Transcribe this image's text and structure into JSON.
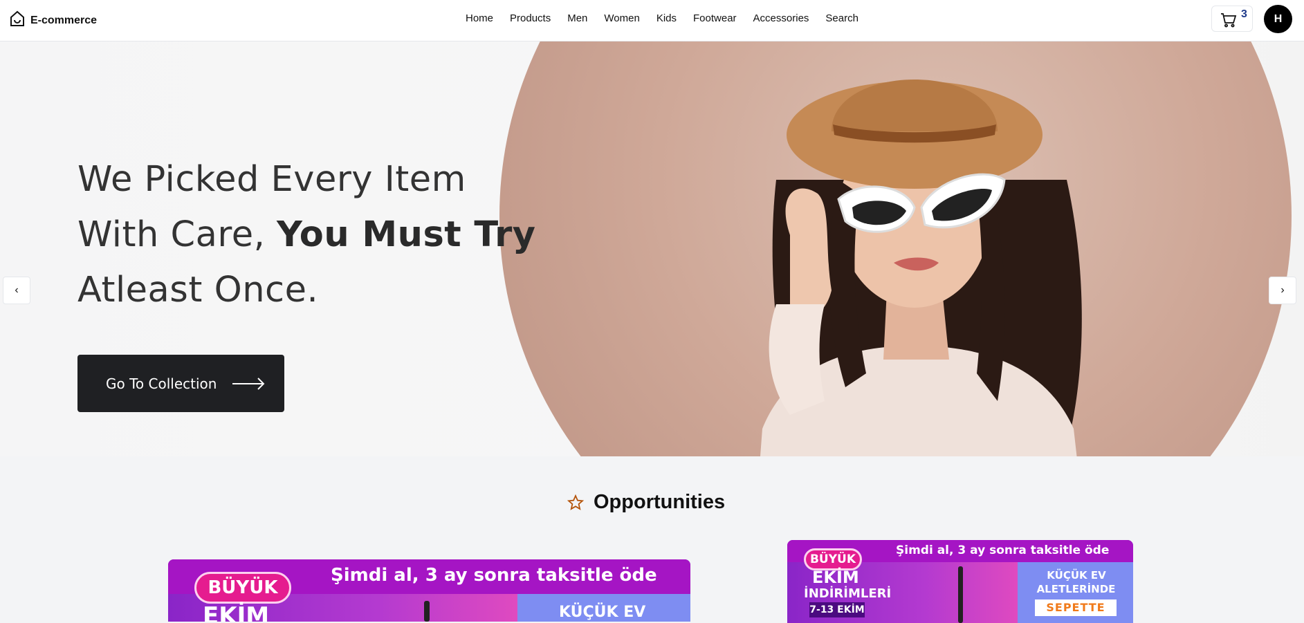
{
  "app": {
    "name": "E-commerce"
  },
  "nav": {
    "links": [
      "Home",
      "Products",
      "Men",
      "Women",
      "Kids",
      "Footwear",
      "Accessories",
      "Search"
    ]
  },
  "cart": {
    "count": "3"
  },
  "user": {
    "initial": "H"
  },
  "hero": {
    "line1": "We Picked Every Item",
    "line2_regular": "With Care, ",
    "line2_bold": "You Must Try",
    "line3": "Atleast Once.",
    "cta_label": "Go To Collection"
  },
  "opportunities": {
    "title": "Opportunities",
    "banner_left": {
      "headline": "Şimdi al, 3 ay sonra taksitle öde",
      "badge": "BÜYÜK",
      "big": "EKİM",
      "right_text": "KÜÇÜK EV"
    },
    "banner_right": {
      "headline": "Şimdi al, 3 ay sonra taksitle öde",
      "badge": "BÜYÜK",
      "big1": "EKİM",
      "big2": "İNDİRİMLERİ",
      "dates": "7-13 EKİM",
      "right_text1": "KÜÇÜK EV",
      "right_text2": "ALETLERİNDE",
      "right_cta": "SEPETTE"
    }
  },
  "colors": {
    "accent": "#1f2023",
    "cart_count": "#1e3a8a",
    "star": "#b45309"
  }
}
